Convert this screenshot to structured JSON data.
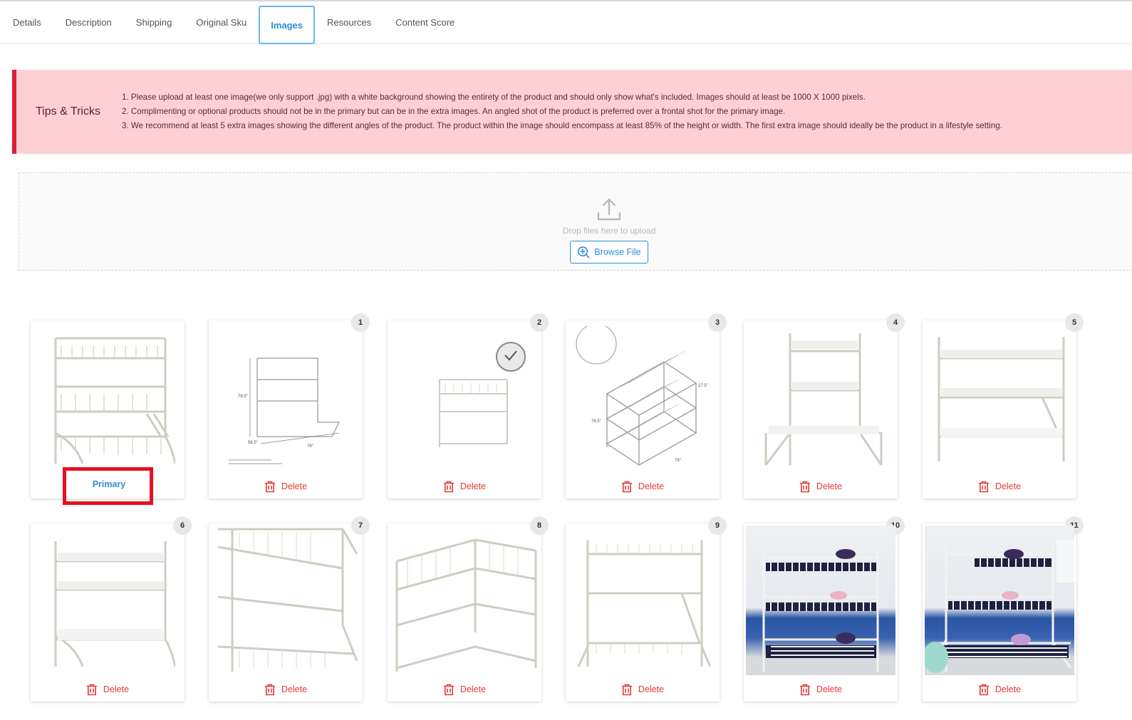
{
  "tabs": [
    {
      "label": "Details",
      "active": false
    },
    {
      "label": "Description",
      "active": false
    },
    {
      "label": "Shipping",
      "active": false
    },
    {
      "label": "Original Sku",
      "active": false
    },
    {
      "label": "Images",
      "active": true
    },
    {
      "label": "Resources",
      "active": false
    },
    {
      "label": "Content Score",
      "active": false
    }
  ],
  "tips": {
    "title": "Tips & Tricks",
    "items": [
      "1. Please upload at least one image(we only support .jpg) with a white background showing the entirety of the product and should only show what's included. Images should at least be 1000 X 1000 pixels.",
      "2. Complimenting or optional products should not be in the primary but can be in the extra images. An angled shot of the product is preferred over a frontal shot for the primary image.",
      "3. We recommend at least 5 extra images showing the different angles of the product. The product within the image should encompass at least 85% of the height or width. The first extra image should ideally be the product in a lifestyle setting."
    ],
    "accent_color": "#e01f33",
    "background_color": "#fdd0d5"
  },
  "upload": {
    "drop_text": "Drop files here to upload",
    "browse_label": "Browse File"
  },
  "images": {
    "primary_label": "Primary",
    "delete_label": "Delete",
    "cards": [
      {
        "badge": "",
        "is_primary": true
      },
      {
        "badge": "1"
      },
      {
        "badge": "2"
      },
      {
        "badge": "3"
      },
      {
        "badge": "4"
      },
      {
        "badge": "5"
      },
      {
        "badge": "6"
      },
      {
        "badge": "7"
      },
      {
        "badge": "8"
      },
      {
        "badge": "9"
      },
      {
        "badge": "10"
      },
      {
        "badge": "11"
      }
    ]
  },
  "colors": {
    "accent_blue": "#2a8fd8",
    "delete_red": "#e53935",
    "highlight_red": "#e8101e"
  }
}
